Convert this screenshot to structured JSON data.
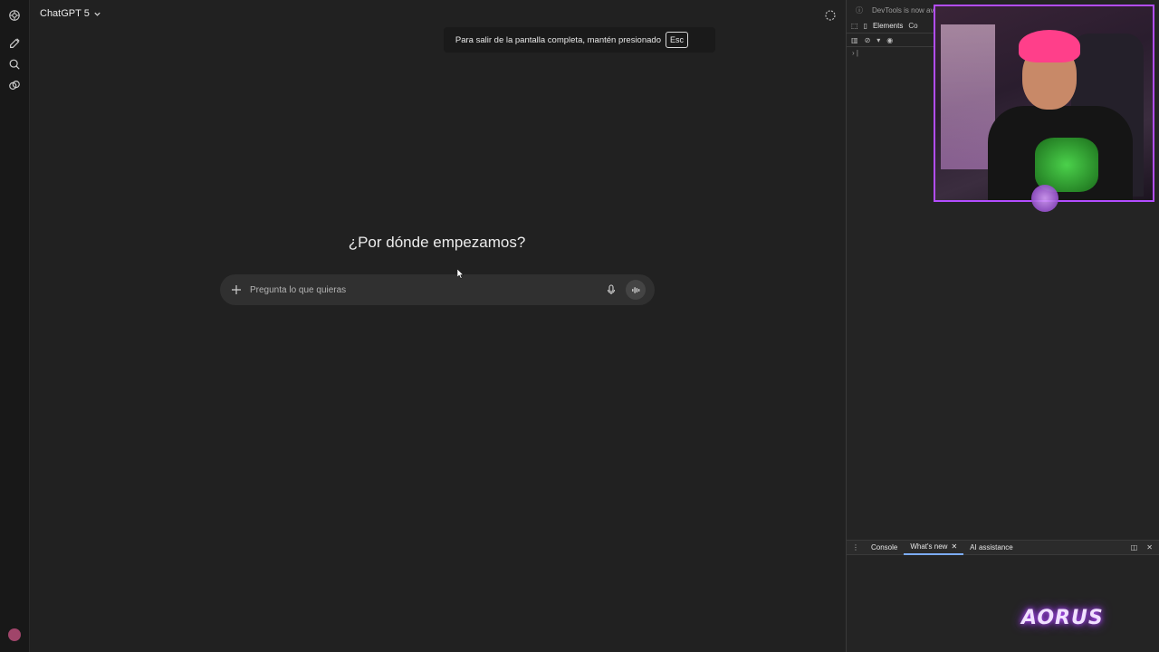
{
  "app": {
    "model_label": "ChatGPT 5"
  },
  "rail": {
    "icons": [
      "chatgpt-logo-icon",
      "new-chat-icon",
      "search-icon",
      "library-icon"
    ]
  },
  "toast": {
    "message": "Para salir de la pantalla completa, mantén presionado",
    "key": "Esc"
  },
  "main": {
    "headline": "¿Por dónde empezamos?",
    "composer": {
      "placeholder": "Pregunta lo que quieras"
    }
  },
  "devtools": {
    "notice": "DevTools is now av",
    "tab_elements": "Elements",
    "tab_console_partial": "Co",
    "drawer": {
      "console": "Console",
      "whats_new": "What's new",
      "ai_assistance": "AI assistance"
    }
  },
  "overlay": {
    "brand": "AORUS"
  },
  "colors": {
    "background": "#212121",
    "composer": "#303030",
    "cam_border": "#b34dff",
    "devtools_tab_active": "#7cacf8"
  }
}
